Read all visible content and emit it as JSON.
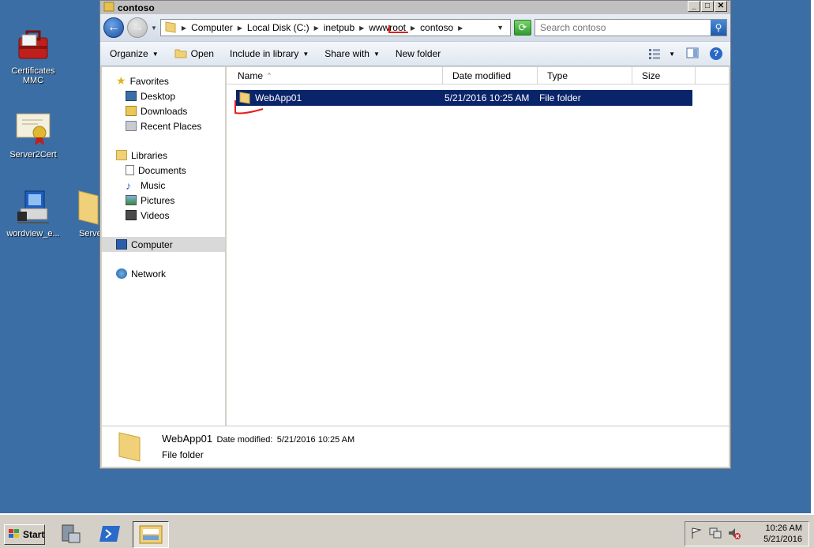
{
  "desktop": {
    "icons": [
      {
        "label": "Certificates MMC"
      },
      {
        "label": "Server2Cert"
      },
      {
        "label": "wordview_e..."
      },
      {
        "label": "Serve"
      }
    ]
  },
  "window": {
    "title": "contoso",
    "controls": {
      "minimize": "_",
      "maximize": "□",
      "close": "✕"
    }
  },
  "address": {
    "crumbs": [
      "Computer",
      "Local Disk (C:)",
      "inetpub",
      "wwwroot",
      "contoso"
    ],
    "search_placeholder": "Search contoso"
  },
  "toolbar": {
    "organize": "Organize",
    "open": "Open",
    "include_in_library": "Include in library",
    "share_with": "Share with",
    "new_folder": "New folder"
  },
  "navpane": {
    "favorites": "Favorites",
    "desktop": "Desktop",
    "downloads": "Downloads",
    "recent_places": "Recent Places",
    "libraries": "Libraries",
    "documents": "Documents",
    "music": "Music",
    "pictures": "Pictures",
    "videos": "Videos",
    "computer": "Computer",
    "network": "Network"
  },
  "columns": {
    "name": "Name",
    "date_modified": "Date modified",
    "type": "Type",
    "size": "Size"
  },
  "files": [
    {
      "name": "WebApp01",
      "date_modified": "5/21/2016 10:25 AM",
      "type": "File folder",
      "size": ""
    }
  ],
  "details": {
    "name": "WebApp01",
    "date_label": "Date modified:",
    "date_value": "5/21/2016 10:25 AM",
    "type": "File folder"
  },
  "taskbar": {
    "start": "Start",
    "time": "10:26 AM",
    "date": "5/21/2016"
  },
  "colors": {
    "desktop": "#3b6ea5",
    "selection": "#0a246a",
    "annotation": "#e0201c"
  }
}
